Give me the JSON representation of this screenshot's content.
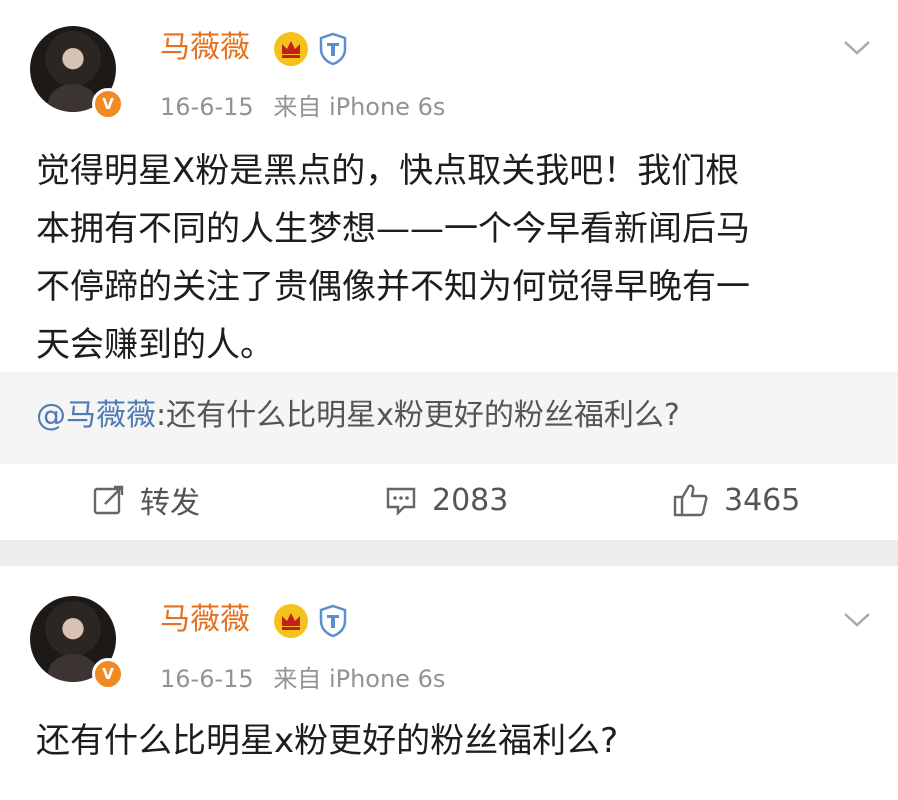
{
  "posts": [
    {
      "author": "马薇薇",
      "verified_glyph": "V",
      "meta": {
        "date": "16-6-15",
        "source": "来自 iPhone 6s"
      },
      "badge_icons": [
        "crown-icon",
        "shield-badge-icon"
      ],
      "text_lines": [
        "觉得明星X粉是黑点的，快点取关我吧！我们根",
        "本拥有不同的人生梦想——一个今早看新闻后马",
        "不停蹄的关注了贵偶像并不知为何觉得早晚有一",
        "天会赚到的人。"
      ],
      "quoted": {
        "mention": "@马薇薇",
        "text": ":还有什么比明星x粉更好的粉丝福利么?"
      },
      "actions": {
        "repost_label": "转发",
        "comment_count": "2083",
        "like_count": "3465"
      }
    },
    {
      "author": "马薇薇",
      "verified_glyph": "V",
      "meta": {
        "date": "16-6-15",
        "source": "来自 iPhone 6s"
      },
      "badge_icons": [
        "crown-icon",
        "shield-badge-icon"
      ],
      "text_lines": [
        "还有什么比明星x粉更好的粉丝福利么?"
      ]
    }
  ],
  "colors": {
    "name": "#e5701d",
    "mention": "#4f7bb5",
    "meta": "#939393",
    "crown": "#f4c21a",
    "verified": "#f28a24"
  }
}
